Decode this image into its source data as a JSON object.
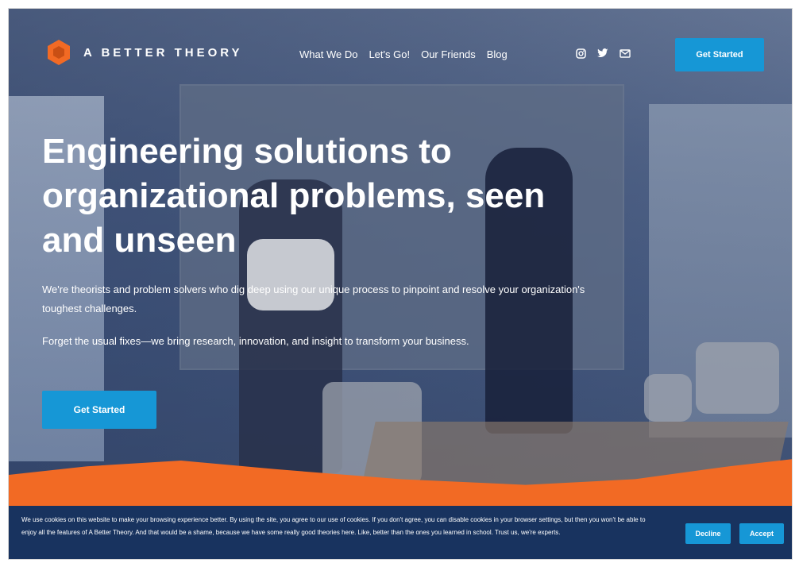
{
  "brand": {
    "name": "A BETTER THEORY",
    "logo_color": "#f26a24"
  },
  "nav": {
    "items": [
      "What We Do",
      "Let's Go!",
      "Our Friends",
      "Blog"
    ]
  },
  "social": {
    "icons": [
      "instagram-icon",
      "twitter-icon",
      "email-icon"
    ]
  },
  "header": {
    "cta_label": "Get Started",
    "accent": "#1697d6"
  },
  "hero": {
    "title": "Engineering solutions to organizational problems, seen and unseen",
    "paragraph_1": "We're theorists and problem solvers who dig deep using our unique process to pinpoint and resolve your organization's toughest challenges.",
    "paragraph_2": "Forget the usual fixes—we bring research, innovation, and insight to transform your business.",
    "cta_label": "Get Started"
  },
  "cookie_banner": {
    "text": "We use cookies on this website to make your browsing experience better. By using the site, you agree to our use of cookies. If you don't agree, you can disable cookies in your browser settings, but then you won't be able to enjoy all the features of A Better Theory. And that would be a shame, because we have some really good theories here. Like, better than the ones you learned in school. Trust us, we're experts.",
    "decline_label": "Decline",
    "accept_label": "Accept",
    "background": "#18335f"
  }
}
